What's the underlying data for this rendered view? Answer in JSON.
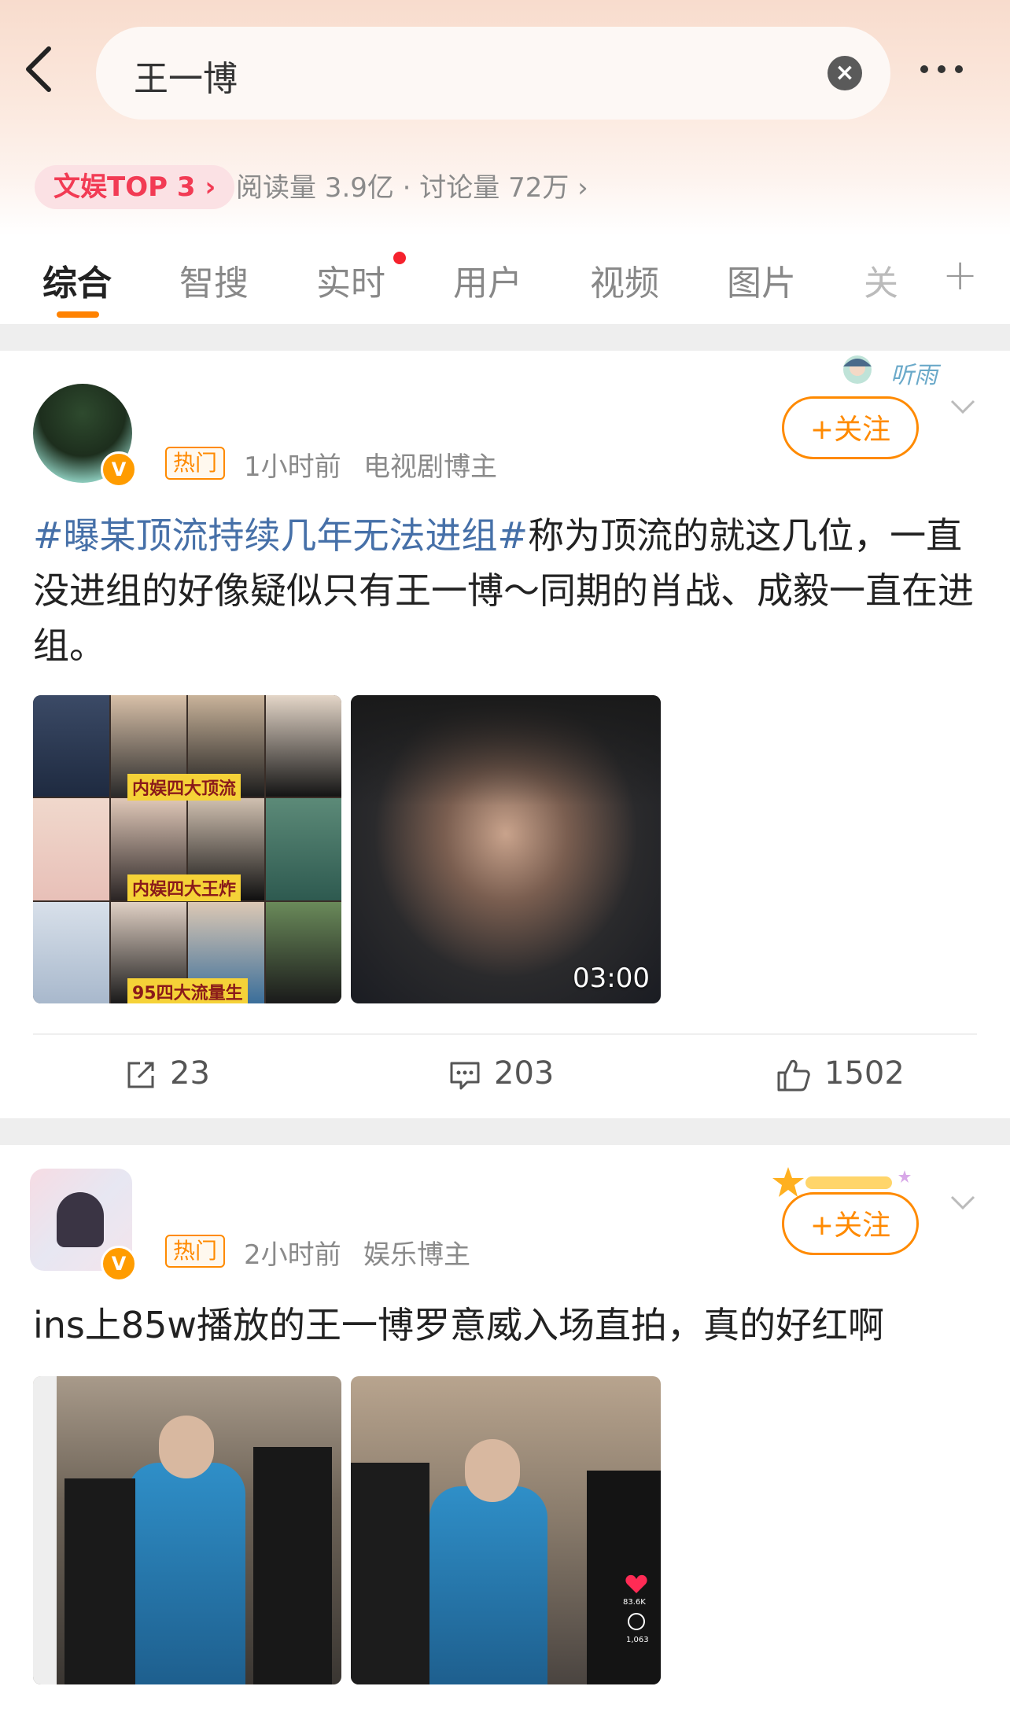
{
  "search": {
    "query": "王一博",
    "clear_icon": "close-circle-icon"
  },
  "topic": {
    "badge": "文娱TOP 3 ›",
    "stats": "阅读量 3.9亿 · 讨论量 72万 ›"
  },
  "tabs": [
    "综合",
    "智搜",
    "实时",
    "用户",
    "视频",
    "图片",
    "关"
  ],
  "colors": {
    "accent": "#ff8a00",
    "hashtag": "#4670a8",
    "badge_red": "#f23b54"
  },
  "posts": [
    {
      "hot_label": "热门",
      "time": "1小时前",
      "role": "电视剧博主",
      "follow_label": "+关注",
      "decoration_text": "听雨",
      "hashtag": "#曝某顶流持续几年无法进组#",
      "body": "称为顶流的就这几位，一直没进组的好像疑似只有王一博～同期的肖战、成毅一直在进组。",
      "image_captions": [
        "内娱四大顶流",
        "内娱四大王炸",
        "95四大流量生"
      ],
      "video_duration": "03:00",
      "shares": "23",
      "comments": "203",
      "likes": "1502"
    },
    {
      "hot_label": "热门",
      "time": "2小时前",
      "role": "娱乐博主",
      "follow_label": "+关注",
      "body": "ins上85w播放的王一博罗意威入场直拍，真的好红啊",
      "overlay_likes": "83.6K",
      "overlay_comments": "1,063"
    }
  ]
}
